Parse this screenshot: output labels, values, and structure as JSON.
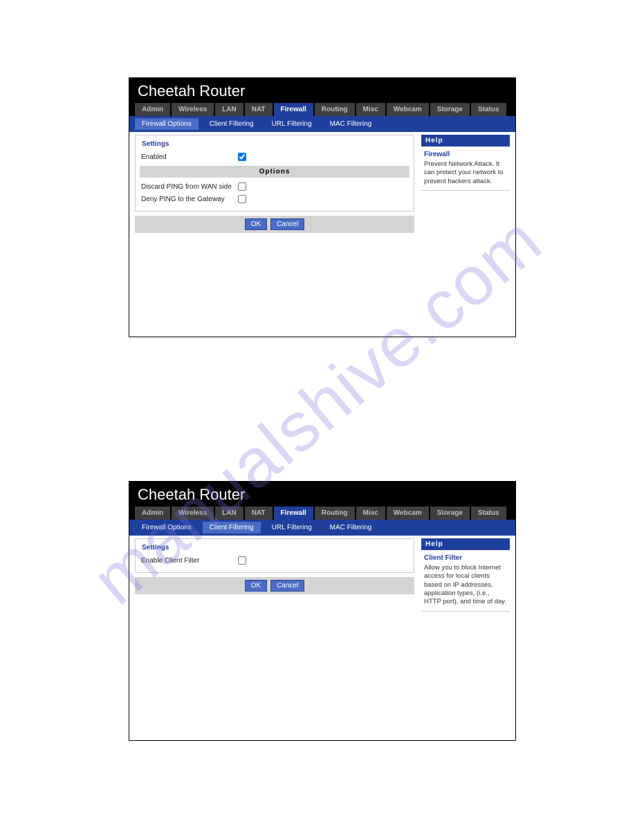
{
  "watermark": "manualshive.com",
  "brand_title": "Cheetah Router",
  "main_tabs": [
    "Admin",
    "Wireless",
    "LAN",
    "NAT",
    "Firewall",
    "Routing",
    "Misc",
    "Webcam",
    "Storage",
    "Status"
  ],
  "sub_tabs": [
    "Firewall Options",
    "Client Filtering",
    "URL Filtering",
    "MAC Filtering"
  ],
  "screen1": {
    "active_sub": "Firewall Options",
    "settings_legend": "Settings",
    "rows": {
      "enabled": {
        "label": "Enabled",
        "checked": true
      },
      "options_header": "Options",
      "discard_ping": {
        "label": "Discard PING from WAN side",
        "checked": false
      },
      "deny_ping": {
        "label": "Deny PING to the Gateway",
        "checked": false
      }
    },
    "buttons": {
      "ok": "OK",
      "cancel": "Cancel"
    },
    "help": {
      "header": "Help",
      "title": "Firewall",
      "text": "Prevent Network Attack. It can protect your network to prevent hackers attack."
    }
  },
  "screen2": {
    "active_sub": "Client Filtering",
    "settings_legend": "Settings",
    "rows": {
      "enable_client": {
        "label": "Enable Client Filter",
        "checked": false
      }
    },
    "buttons": {
      "ok": "OK",
      "cancel": "Cancel"
    },
    "help": {
      "header": "Help",
      "title": "Client Filter",
      "text": "Allow you to block Internet access for local clients based on IP addresses, application types, (i.e., HTTP port), and time of day."
    }
  }
}
